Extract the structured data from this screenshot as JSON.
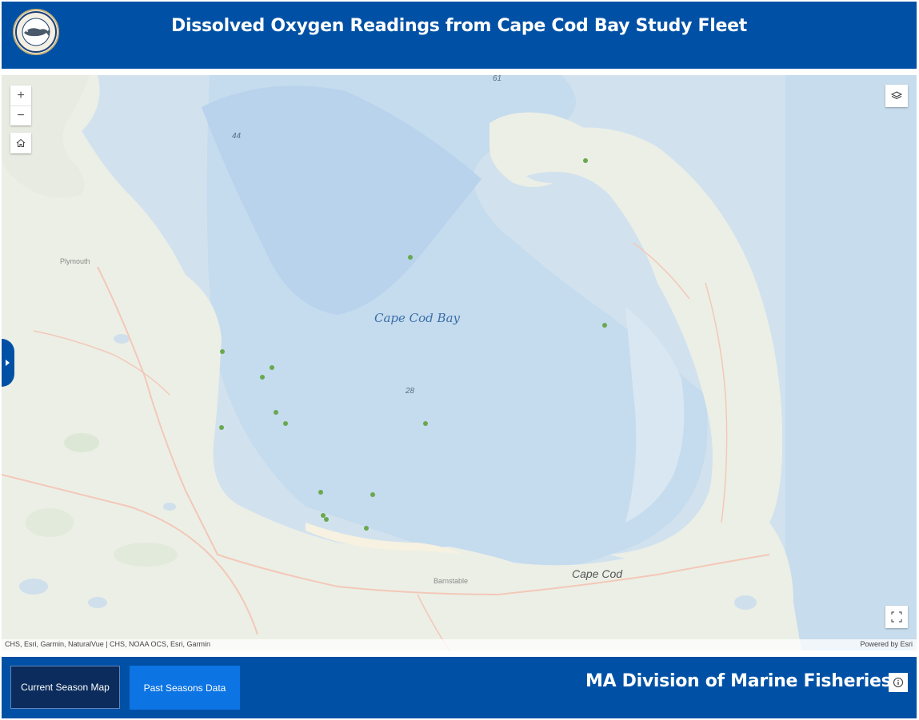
{
  "header": {
    "title": "Dissolved Oxygen Readings from Cape Cod Bay Study Fleet",
    "logo_text": "Commonwealth of Massachusetts Division of Marine Fisheries"
  },
  "map": {
    "labels": {
      "bay": "Cape Cod Bay",
      "cape": "Cape Cod",
      "plymouth": "Plymouth",
      "barnstable": "Barnstable",
      "depth_61": "61",
      "depth_44": "44",
      "depth_28": "28"
    },
    "controls": {
      "zoom_in": "+",
      "zoom_out": "−"
    },
    "attribution_left": "CHS, Esri, Garmin, NaturalVue | CHS, NOAA OCS, Esri, Garmin",
    "attribution_right": "Powered by Esri",
    "point_color": "#6aa84f"
  },
  "footer": {
    "current_season_label": "Current Season Map",
    "past_seasons_label": "Past Seasons Data",
    "org_title": "MA Division of Marine Fisheries"
  },
  "colors": {
    "brand_blue": "#0051a5",
    "active_button": "#0b2c5c",
    "secondary_button": "#0c74e3"
  }
}
